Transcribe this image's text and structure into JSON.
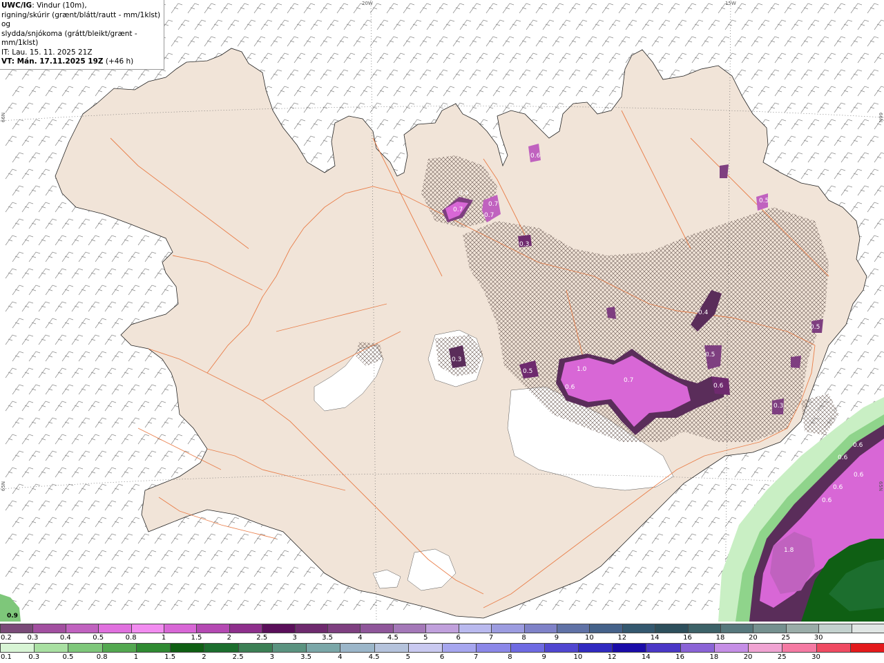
{
  "info": {
    "title": "UWC/IG",
    "title_rest": ": Vindur (10m),",
    "line2": "rigning/skúrir (grænt/blátt/rautt - mm/1klst) og",
    "line3": "slydda/snjókoma (grátt/bleikt/grænt - mm/1klst)",
    "line4": "IT: Lau. 15. 11. 2025 21Z",
    "line5_bold": "VT: Mán. 17.11.2025 19Z",
    "line5_rest": " (+46 h)"
  },
  "graticule": {
    "top_20w": "20W",
    "top_15w": "15W",
    "left_66n": "66N",
    "left_65n": "65N",
    "right_66n": "66N",
    "right_65n": "65N"
  },
  "map_labels": [
    "0.4",
    "0.7",
    "0.7",
    "0.7",
    "0.6",
    "0.3",
    "0.3",
    "0.5",
    "1.0",
    "0.6",
    "0.7",
    "0.4",
    "0.5",
    "0.6",
    "0.3",
    "0.6",
    "0.6",
    "0.6",
    "0.6",
    "0.6",
    "1.8",
    "0.9",
    "0.5",
    "0.5"
  ],
  "legend_snow": {
    "labels": [
      "0.2",
      "0.3",
      "0.4",
      "0.5",
      "0.8",
      "1",
      "1.5",
      "2",
      "2.5",
      "3",
      "3.5",
      "4",
      "4.5",
      "5",
      "6",
      "7",
      "8",
      "9",
      "10",
      "12",
      "14",
      "16",
      "18",
      "20",
      "25",
      "30"
    ],
    "colors": [
      "#7a4a78",
      "#a24fa0",
      "#c062bf",
      "#e070de",
      "#f28cf0",
      "#d867d6",
      "#b449b2",
      "#8e2f8c",
      "#5a0f5a",
      "#6e2a6e",
      "#7e3f80",
      "#8f569a",
      "#a478b8",
      "#c0a0dc",
      "#b9b9ee",
      "#9c9ce0",
      "#7f82c8",
      "#6072a6",
      "#45628a",
      "#34586f",
      "#2d4f5c",
      "#3c6268",
      "#56787c",
      "#75908f",
      "#9aaca8",
      "#c3d1ce",
      "#e0e6e4"
    ]
  },
  "legend_rain": {
    "labels": [
      "0.1",
      "0.3",
      "0.5",
      "0.8",
      "1",
      "1.5",
      "2",
      "2.5",
      "3",
      "3.5",
      "4",
      "4.5",
      "5",
      "6",
      "7",
      "8",
      "9",
      "10",
      "12",
      "14",
      "16",
      "18",
      "20",
      "25",
      "30"
    ],
    "colors": [
      "#d8f5d5",
      "#a9e0a2",
      "#7ec77a",
      "#53a850",
      "#2f8a32",
      "#0f5f14",
      "#1c6e2e",
      "#3c7f55",
      "#5b9380",
      "#7aa7a8",
      "#9bb6c9",
      "#b5c3dc",
      "#c9c9f0",
      "#a6a6ef",
      "#8b87e8",
      "#6e6ae2",
      "#5046d0",
      "#3029c0",
      "#1a0ca8",
      "#4a37c6",
      "#8a63d6",
      "#c58ee6",
      "#f0a3d2",
      "#f57aa3",
      "#ef4b62",
      "#e31a1c"
    ]
  }
}
